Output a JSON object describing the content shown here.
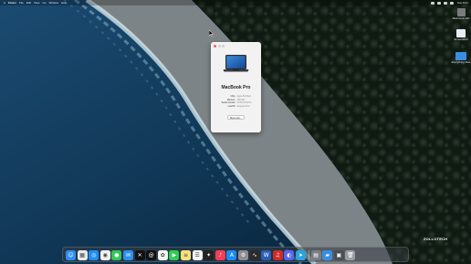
{
  "menubar": {
    "app_menu": "Finder",
    "menus": [
      "File",
      "Edit",
      "View",
      "Go",
      "Window",
      "Help"
    ],
    "status_icons": [
      "wifi-icon",
      "control-center-icon",
      "battery-icon",
      "search-icon"
    ],
    "clock": "Sun 9:41"
  },
  "desktop_icons": [
    {
      "label": "Macintosh HD",
      "icon": "hard-drive-icon",
      "color": "#7b7b7b"
    },
    {
      "label": "Screenshot",
      "icon": "screenshot-icon",
      "color": "#e9eef4"
    },
    {
      "label": "Everything Mac",
      "icon": "folder-icon",
      "color": "#3b8de0"
    }
  ],
  "about_window": {
    "model": "MacBook Pro",
    "specs": [
      {
        "key": "Chip",
        "value": "Apple M4 Max"
      },
      {
        "key": "Memory",
        "value": "128 GB"
      },
      {
        "key": "Serial number",
        "value": "XXXXXXXXXX"
      },
      {
        "key": "macOS",
        "value": "Sequoia 15.2"
      }
    ],
    "more_info_label": "More Info..."
  },
  "watermark": "ZOLLOTECH",
  "dock": {
    "apps": [
      {
        "name": "finder",
        "color": "#2f8cf3",
        "glyph": "☺"
      },
      {
        "name": "launchpad",
        "color": "#e8e8ec",
        "glyph": "▦"
      },
      {
        "name": "safari",
        "color": "#1f8ef5",
        "glyph": "◎"
      },
      {
        "name": "chrome",
        "color": "#f0f0f0",
        "glyph": "◉"
      },
      {
        "name": "messages",
        "color": "#31c759",
        "glyph": "●"
      },
      {
        "name": "mail",
        "color": "#2f8ff0",
        "glyph": "✉"
      },
      {
        "name": "x",
        "color": "#111111",
        "glyph": "✕"
      },
      {
        "name": "threads",
        "color": "#111111",
        "glyph": "@"
      },
      {
        "name": "photos",
        "color": "#f4f4f4",
        "glyph": "✿"
      },
      {
        "name": "facetime",
        "color": "#2fcb54",
        "glyph": "▶"
      },
      {
        "name": "notes",
        "color": "#fbe07a",
        "glyph": "≡"
      },
      {
        "name": "reminders",
        "color": "#f4f4f4",
        "glyph": "☰"
      },
      {
        "name": "final-cut",
        "color": "#222222",
        "glyph": "✦"
      },
      {
        "name": "music",
        "color": "#fa3d55",
        "glyph": "♪"
      },
      {
        "name": "app-store",
        "color": "#1c8cf5",
        "glyph": "A"
      },
      {
        "name": "settings",
        "color": "#8d8d93",
        "glyph": "⚙"
      },
      {
        "name": "activity-monitor",
        "color": "#2b2b2b",
        "glyph": "∿"
      },
      {
        "name": "word",
        "color": "#2b5eb8",
        "glyph": "W"
      },
      {
        "name": "scrobbles",
        "color": "#cf2b2b",
        "glyph": "♫"
      },
      {
        "name": "discord",
        "color": "#5865f2",
        "glyph": "◐"
      },
      {
        "name": "telegram",
        "color": "#2aa3e0",
        "glyph": "➤"
      }
    ],
    "right_items": [
      {
        "name": "preview",
        "color": "#7a7f86",
        "glyph": "▤"
      },
      {
        "name": "folder",
        "color": "#3b8de0",
        "glyph": "▰"
      },
      {
        "name": "screenshots",
        "color": "#4a4f56",
        "glyph": "▣"
      },
      {
        "name": "trash",
        "color": "#9a9ea4",
        "glyph": "🗑"
      }
    ]
  }
}
